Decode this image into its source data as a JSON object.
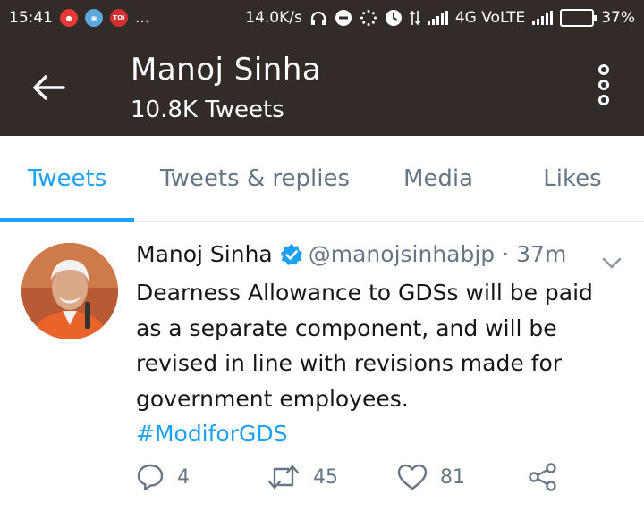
{
  "status_bar": {
    "time": "15:41",
    "notification_icons": [
      "app-red-icon",
      "app-blue-icon",
      "toi-icon"
    ],
    "toi_label": "TOI",
    "more": "...",
    "speed": "14.0K/s",
    "network": "4G VoLTE",
    "battery": "37%",
    "battery_level": 0.37,
    "colors": {
      "bar_bg": "#332b28",
      "battery_fill": "#e8892e"
    }
  },
  "header": {
    "title": "Manoj Sinha",
    "subtitle": "10.8K Tweets"
  },
  "tabs": [
    {
      "label": "Tweets",
      "active": true
    },
    {
      "label": "Tweets & replies",
      "active": false
    },
    {
      "label": "Media",
      "active": false
    },
    {
      "label": "Likes",
      "active": false
    }
  ],
  "tweet": {
    "author_name": "Manoj Sinha",
    "handle": "@manojsinhabjp",
    "separator": "·",
    "time": "37m",
    "text": "Dearness Allowance to GDSs will be paid as a separate component, and will be revised in line with revisions made for government employees.",
    "hashtag": "#ModiforGDS",
    "replies": "4",
    "retweets": "45",
    "likes": "81"
  },
  "colors": {
    "accent": "#1da1f2",
    "muted": "#657786",
    "text": "#14171a"
  }
}
